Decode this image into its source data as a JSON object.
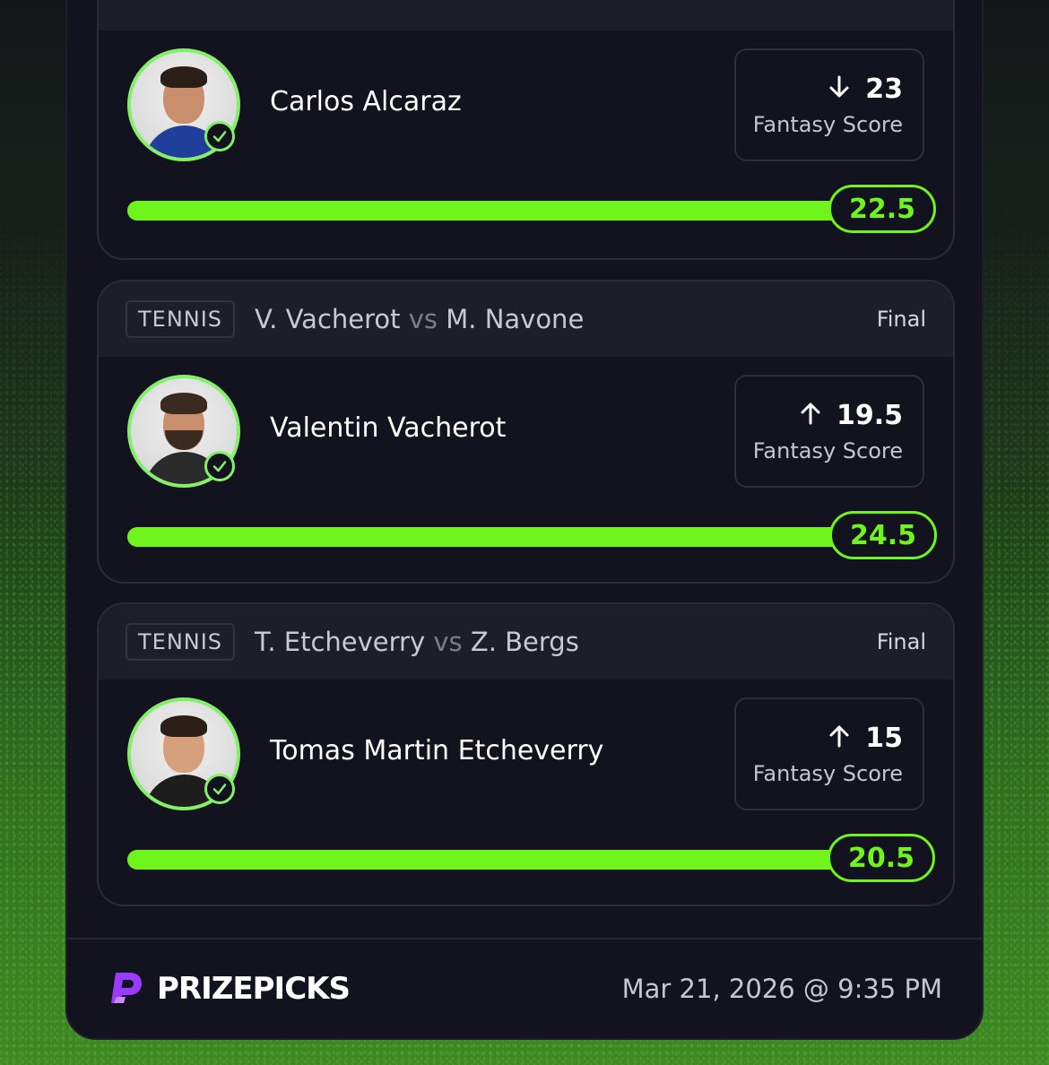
{
  "cards": [
    {
      "sport": "TENNIS",
      "player_a": "V. Vacherot",
      "vs": "vs",
      "player_b": "M. Navone",
      "status": "Final",
      "player_name": "Valentin Vacherot",
      "score_direction_icon": "arrow-up-icon",
      "score_value": "19.5",
      "score_label": "Fantasy Score",
      "result": "24.5",
      "progress": 1.0
    },
    {
      "sport": "TENNIS",
      "player_a": "T. Etcheverry",
      "vs": "vs",
      "player_b": "Z. Bergs",
      "status": "Final",
      "player_name": "Tomas Martin Etcheverry",
      "score_direction_icon": "arrow-up-icon",
      "score_value": "15",
      "score_label": "Fantasy Score",
      "result": "20.5",
      "progress": 1.0
    }
  ],
  "first_card": {
    "player_name": "Carlos Alcaraz",
    "score_direction_icon": "arrow-down-icon",
    "score_value": "23",
    "score_label": "Fantasy Score",
    "result": "22.5",
    "progress": 1.0
  },
  "footer": {
    "brand": "PRIZEPICKS",
    "date": "Mar 21, 2026 @ 9:35 PM"
  },
  "colors": {
    "accent_green": "#6ff51c",
    "avatar_ring": "#84f06a",
    "brand_purple": "#9b3bff",
    "panel_bg": "#13131f"
  }
}
